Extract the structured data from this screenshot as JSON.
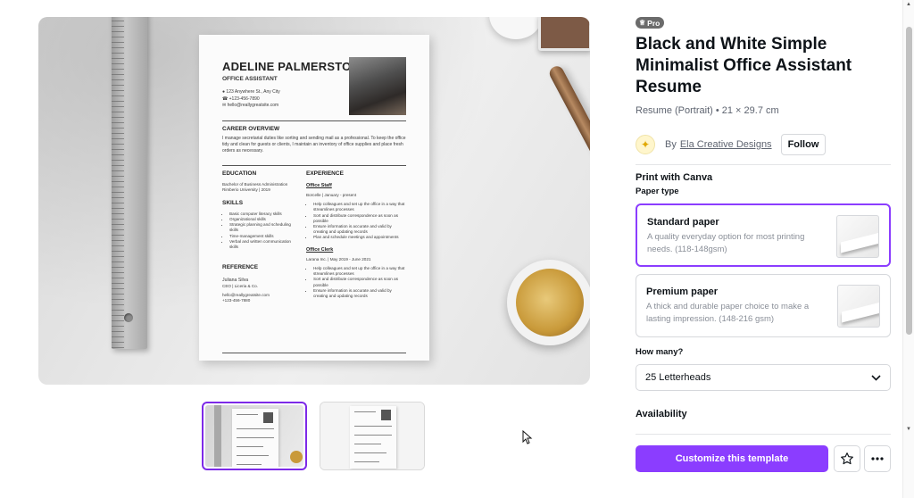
{
  "preview": {
    "resume": {
      "name": "ADELINE PALMERSTON",
      "role": "OFFICE ASSISTANT",
      "contacts": [
        "123 Anywhere St., Any City",
        "+123-456-7890",
        "hello@reallygreatsite.com"
      ],
      "career_heading": "CAREER OVERVIEW",
      "career_text": "I manage secretarial duties like sorting and sending mail as a professional. To keep the office tidy and clean for guests or clients, I maintain an inventory of office supplies and place fresh orders as necessary.",
      "education_heading": "EDUCATION",
      "education": [
        "Bachelor of Business Administration",
        "Rimberio University | 2019"
      ],
      "skills_heading": "SKILLS",
      "skills": [
        "Basic computer literacy skills",
        "Organizational skills",
        "Strategic planning and scheduling skills",
        "Time-management skills",
        "Verbal and written communication skills"
      ],
      "reference_heading": "REFERENCE",
      "reference": [
        "Juliana Silva",
        "CEO | Liceria & Co.",
        "",
        "hello@reallygreatsite.com",
        "+123-456-7880"
      ],
      "experience_heading": "EXPERIENCE",
      "jobs": [
        {
          "title": "Office Staff",
          "meta": "Borcelle | January - present",
          "bullets": [
            "Help colleagues and set up the office in a way that streamlines processes",
            "Sort and distribute correspondence as soon as possible",
            "Ensure information is accurate and valid by creating and updating records",
            "Plan and schedule meetings and appointments"
          ]
        },
        {
          "title": "Office Clerk",
          "meta": "Larana Inc. | May 2019 - June 2021",
          "bullets": [
            "Help colleagues and set up the office in a way that streamlines processes",
            "Sort and distribute correspondence as soon as possible",
            "Ensure information is accurate and valid by creating and updating records"
          ]
        }
      ]
    }
  },
  "panel": {
    "badge": "Pro",
    "title": "Black and White Simple Minimalist Office Assistant Resume",
    "meta": "Resume (Portrait) • 21 × 29.7 cm",
    "by_label": "By",
    "author": "Ela Creative Designs",
    "follow_label": "Follow",
    "print_heading": "Print with Canva",
    "paper_type_heading": "Paper type",
    "options": [
      {
        "title": "Standard paper",
        "desc": "A quality everyday option for most printing needs. (118-148gsm)",
        "selected": true
      },
      {
        "title": "Premium paper",
        "desc": "A thick and durable paper choice to make a lasting impression. (148-216 gsm)",
        "selected": false
      }
    ],
    "how_many_heading": "How many?",
    "quantity_value": "25 Letterheads",
    "availability_heading": "Availability",
    "cta_label": "Customize this template"
  },
  "colors": {
    "accent": "#8b3dff",
    "selected_border": "#8b3dff",
    "text": "#0e1318",
    "muted": "#5e6470"
  },
  "icons": {
    "crown": "crown-icon",
    "chevron": "chevron-down-icon",
    "star": "star-icon",
    "more": "more-horizontal-icon"
  }
}
